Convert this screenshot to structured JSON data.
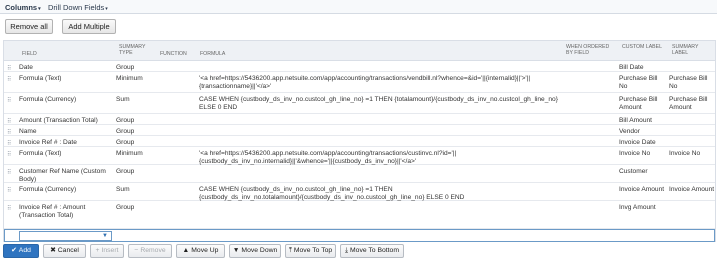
{
  "tabs": [
    {
      "label": "Columns"
    },
    {
      "label": "Drill Down Fields"
    }
  ],
  "top_buttons": {
    "remove_all": "Remove all",
    "add_multiple": "Add Multiple"
  },
  "columns": [
    "Field",
    "Summary Type",
    "Function",
    "Formula",
    "When Ordered By Field",
    "Custom Label",
    "Summary Label"
  ],
  "rows": [
    {
      "field": "Date",
      "summary": "Group",
      "function": "",
      "formula": "",
      "when": "",
      "custom": "Bill Date",
      "summary_label": ""
    },
    {
      "field": "Formula (Text)",
      "summary": "Minimum",
      "function": "",
      "formula": "'<a href=https://5436200.app.netsuite.com/app/accounting/transactions/vendbill.nl?whence=&id='||{internalid}||'>'||{transactionname}||'</a>'",
      "when": "",
      "custom": "Purchase Bill No",
      "summary_label": "Purchase Bill No"
    },
    {
      "field": "Formula (Currency)",
      "summary": "Sum",
      "function": "",
      "formula": "CASE WHEN {custbody_ds_inv_no.custcol_gh_line_no} =1 THEN {totalamount}/{custbody_ds_inv_no.custcol_gh_line_no} ELSE 0 END",
      "when": "",
      "custom": "Purchase Bill Amount",
      "summary_label": "Purchase Bill Amount"
    },
    {
      "field": "Amount (Transaction Total)",
      "summary": "Group",
      "function": "",
      "formula": "",
      "when": "",
      "custom": "Bill Amount",
      "summary_label": ""
    },
    {
      "field": "Name",
      "summary": "Group",
      "function": "",
      "formula": "",
      "when": "",
      "custom": "Vendor",
      "summary_label": ""
    },
    {
      "field": "Invoice Ref # : Date",
      "summary": "Group",
      "function": "",
      "formula": "",
      "when": "",
      "custom": "Invoice Date",
      "summary_label": ""
    },
    {
      "field": "Formula (Text)",
      "summary": "Minimum",
      "function": "",
      "formula": "'<a href=https://5436200.app.netsuite.com/app/accounting/transactions/custinvc.nl?id='||{custbody_ds_inv_no.internalid}||'&whence='||{custbody_ds_inv_no}||'</a>'",
      "when": "",
      "custom": "Invoice No",
      "summary_label": "Invoice No"
    },
    {
      "field": "Customer Ref Name (Custom Body)",
      "summary": "Group",
      "function": "",
      "formula": "",
      "when": "",
      "custom": "Customer",
      "summary_label": ""
    },
    {
      "field": "Formula (Currency)",
      "summary": "Sum",
      "function": "",
      "formula": "CASE WHEN {custbody_ds_inv_no.custcol_gh_line_no} =1 THEN {custbody_ds_inv_no.totalamount}/{custbody_ds_inv_no.custcol_gh_line_no} ELSE 0 END",
      "when": "",
      "custom": "Invoice Amount",
      "summary_label": "Invoice Amount"
    },
    {
      "field": "Invoice Ref # : Amount (Transaction Total)",
      "summary": "Group",
      "function": "",
      "formula": "",
      "when": "",
      "custom": "Invg Amount",
      "summary_label": ""
    }
  ],
  "actions": [
    {
      "label": "Add",
      "icon": "check-icon",
      "glyph": "✔",
      "state": "primary"
    },
    {
      "label": "Cancel",
      "icon": "close-icon",
      "glyph": "✖",
      "state": "normal"
    },
    {
      "label": "Insert",
      "icon": "insert-icon",
      "glyph": "+",
      "state": "disabled"
    },
    {
      "label": "Remove",
      "icon": "remove-icon",
      "glyph": "−",
      "state": "disabled"
    },
    {
      "label": "Move Up",
      "icon": "move-up-icon",
      "glyph": "▲",
      "state": "normal"
    },
    {
      "label": "Move Down",
      "icon": "move-down-icon",
      "glyph": "▼",
      "state": "normal"
    },
    {
      "label": "Move To Top",
      "icon": "move-to-top-icon",
      "glyph": "⤒",
      "state": "normal"
    },
    {
      "label": "Move To Bottom",
      "icon": "move-to-bottom-icon",
      "glyph": "⤓",
      "state": "normal"
    }
  ],
  "colors": {
    "accent": "#2f74c0",
    "header_bg": "#eef1f5"
  }
}
